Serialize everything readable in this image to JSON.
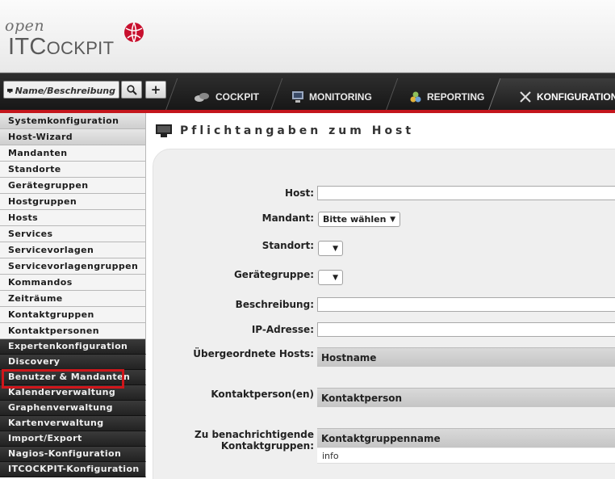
{
  "logo": {
    "open": "open",
    "brand_big_i": "IT",
    "brand_c": "C",
    "brand_rest": "OCKPIT"
  },
  "search": {
    "placeholder": "Name/Beschreibung",
    "search_icon": "magnifier-icon",
    "add_icon": "plus-icon",
    "add_label": "+"
  },
  "topnav": {
    "tabs": [
      {
        "label": "COCKPIT",
        "icon": "cockpit-icon"
      },
      {
        "label": "MONITORING",
        "icon": "monitoring-icon"
      },
      {
        "label": "REPORTING",
        "icon": "reporting-icon"
      },
      {
        "label": "KONFIGURATION",
        "icon": "tools-icon",
        "active": true
      }
    ],
    "accent_color": "#c4161c"
  },
  "sidebar": {
    "items": [
      {
        "label": "Systemkonfiguration",
        "style": "section"
      },
      {
        "label": "Host-Wizard",
        "style": "section"
      },
      {
        "label": "Mandanten"
      },
      {
        "label": "Standorte"
      },
      {
        "label": "Gerätegruppen"
      },
      {
        "label": "Hostgruppen"
      },
      {
        "label": "Hosts"
      },
      {
        "label": "Services"
      },
      {
        "label": "Servicevorlagen"
      },
      {
        "label": "Servicevorlagengruppen"
      },
      {
        "label": "Kommandos"
      },
      {
        "label": "Zeiträume"
      },
      {
        "label": "Kontaktgruppen"
      },
      {
        "label": "Kontaktpersonen"
      },
      {
        "label": "Expertenkonfiguration",
        "style": "dark"
      },
      {
        "label": "Discovery",
        "style": "dark"
      },
      {
        "label": "Benutzer & Mandanten",
        "style": "dark",
        "highlighted": true
      },
      {
        "label": "Kalenderverwaltung",
        "style": "dark"
      },
      {
        "label": "Graphenverwaltung",
        "style": "dark"
      },
      {
        "label": "Kartenverwaltung",
        "style": "dark"
      },
      {
        "label": "Import/Export",
        "style": "dark"
      },
      {
        "label": "Nagios-Konfiguration",
        "style": "dark"
      },
      {
        "label": "ITCOCKPIT-Konfiguration",
        "style": "dark"
      }
    ],
    "highlight_color": "#d0161b"
  },
  "main": {
    "title": "Pflichtangaben zum Host",
    "title_icon": "monitor-icon",
    "form": {
      "host_label": "Host:",
      "host_value": "",
      "mandant_label": "Mandant:",
      "mandant_value": "Bitte wählen",
      "standort_label": "Standort:",
      "standort_value": "",
      "geraetegruppe_label": "Gerätegruppe:",
      "geraetegruppe_value": "",
      "beschreibung_label": "Beschreibung:",
      "beschreibung_value": "",
      "ip_label": "IP-Adresse:",
      "ip_value": "",
      "parent_label": "Übergeordnete Hosts:",
      "parent_header": "Hostname",
      "contact_label": "Kontaktperson(en)",
      "contact_header": "Kontaktperson",
      "contactgroups_label_1": "Zu benachrichtigende",
      "contactgroups_label_2": "Kontaktgruppen:",
      "contactgroups_header": "Kontaktgruppenname",
      "contactgroups_row": "info"
    }
  }
}
